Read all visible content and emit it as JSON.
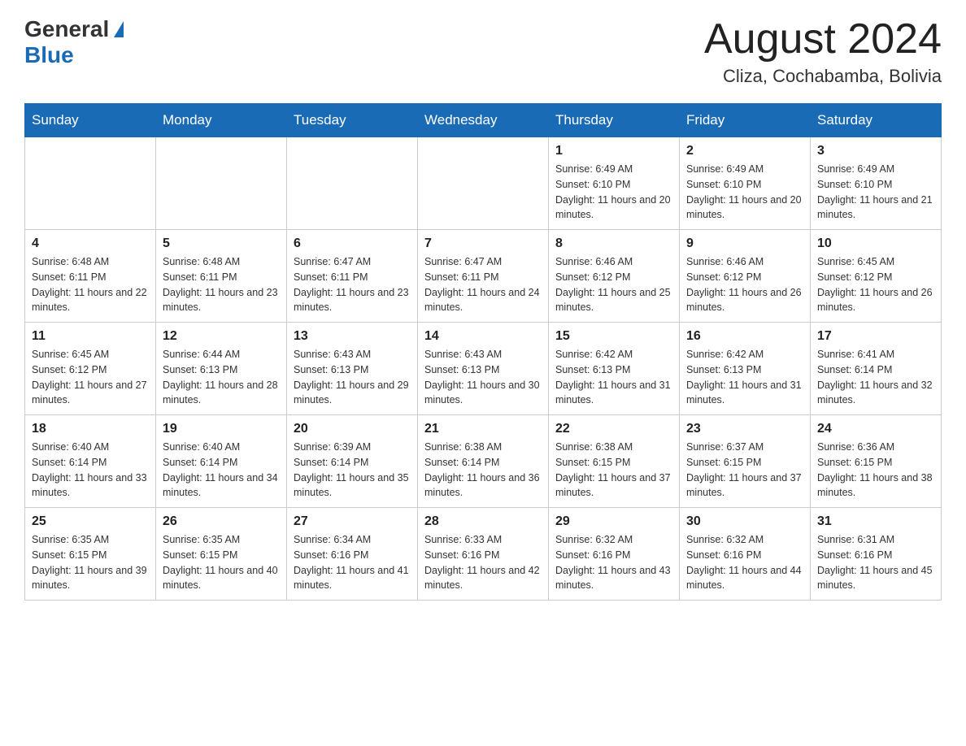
{
  "header": {
    "logo_general": "General",
    "logo_blue": "Blue",
    "title": "August 2024",
    "location": "Cliza, Cochabamba, Bolivia"
  },
  "days_of_week": [
    "Sunday",
    "Monday",
    "Tuesday",
    "Wednesday",
    "Thursday",
    "Friday",
    "Saturday"
  ],
  "weeks": [
    [
      {
        "day": "",
        "info": ""
      },
      {
        "day": "",
        "info": ""
      },
      {
        "day": "",
        "info": ""
      },
      {
        "day": "",
        "info": ""
      },
      {
        "day": "1",
        "info": "Sunrise: 6:49 AM\nSunset: 6:10 PM\nDaylight: 11 hours and 20 minutes."
      },
      {
        "day": "2",
        "info": "Sunrise: 6:49 AM\nSunset: 6:10 PM\nDaylight: 11 hours and 20 minutes."
      },
      {
        "day": "3",
        "info": "Sunrise: 6:49 AM\nSunset: 6:10 PM\nDaylight: 11 hours and 21 minutes."
      }
    ],
    [
      {
        "day": "4",
        "info": "Sunrise: 6:48 AM\nSunset: 6:11 PM\nDaylight: 11 hours and 22 minutes."
      },
      {
        "day": "5",
        "info": "Sunrise: 6:48 AM\nSunset: 6:11 PM\nDaylight: 11 hours and 23 minutes."
      },
      {
        "day": "6",
        "info": "Sunrise: 6:47 AM\nSunset: 6:11 PM\nDaylight: 11 hours and 23 minutes."
      },
      {
        "day": "7",
        "info": "Sunrise: 6:47 AM\nSunset: 6:11 PM\nDaylight: 11 hours and 24 minutes."
      },
      {
        "day": "8",
        "info": "Sunrise: 6:46 AM\nSunset: 6:12 PM\nDaylight: 11 hours and 25 minutes."
      },
      {
        "day": "9",
        "info": "Sunrise: 6:46 AM\nSunset: 6:12 PM\nDaylight: 11 hours and 26 minutes."
      },
      {
        "day": "10",
        "info": "Sunrise: 6:45 AM\nSunset: 6:12 PM\nDaylight: 11 hours and 26 minutes."
      }
    ],
    [
      {
        "day": "11",
        "info": "Sunrise: 6:45 AM\nSunset: 6:12 PM\nDaylight: 11 hours and 27 minutes."
      },
      {
        "day": "12",
        "info": "Sunrise: 6:44 AM\nSunset: 6:13 PM\nDaylight: 11 hours and 28 minutes."
      },
      {
        "day": "13",
        "info": "Sunrise: 6:43 AM\nSunset: 6:13 PM\nDaylight: 11 hours and 29 minutes."
      },
      {
        "day": "14",
        "info": "Sunrise: 6:43 AM\nSunset: 6:13 PM\nDaylight: 11 hours and 30 minutes."
      },
      {
        "day": "15",
        "info": "Sunrise: 6:42 AM\nSunset: 6:13 PM\nDaylight: 11 hours and 31 minutes."
      },
      {
        "day": "16",
        "info": "Sunrise: 6:42 AM\nSunset: 6:13 PM\nDaylight: 11 hours and 31 minutes."
      },
      {
        "day": "17",
        "info": "Sunrise: 6:41 AM\nSunset: 6:14 PM\nDaylight: 11 hours and 32 minutes."
      }
    ],
    [
      {
        "day": "18",
        "info": "Sunrise: 6:40 AM\nSunset: 6:14 PM\nDaylight: 11 hours and 33 minutes."
      },
      {
        "day": "19",
        "info": "Sunrise: 6:40 AM\nSunset: 6:14 PM\nDaylight: 11 hours and 34 minutes."
      },
      {
        "day": "20",
        "info": "Sunrise: 6:39 AM\nSunset: 6:14 PM\nDaylight: 11 hours and 35 minutes."
      },
      {
        "day": "21",
        "info": "Sunrise: 6:38 AM\nSunset: 6:14 PM\nDaylight: 11 hours and 36 minutes."
      },
      {
        "day": "22",
        "info": "Sunrise: 6:38 AM\nSunset: 6:15 PM\nDaylight: 11 hours and 37 minutes."
      },
      {
        "day": "23",
        "info": "Sunrise: 6:37 AM\nSunset: 6:15 PM\nDaylight: 11 hours and 37 minutes."
      },
      {
        "day": "24",
        "info": "Sunrise: 6:36 AM\nSunset: 6:15 PM\nDaylight: 11 hours and 38 minutes."
      }
    ],
    [
      {
        "day": "25",
        "info": "Sunrise: 6:35 AM\nSunset: 6:15 PM\nDaylight: 11 hours and 39 minutes."
      },
      {
        "day": "26",
        "info": "Sunrise: 6:35 AM\nSunset: 6:15 PM\nDaylight: 11 hours and 40 minutes."
      },
      {
        "day": "27",
        "info": "Sunrise: 6:34 AM\nSunset: 6:16 PM\nDaylight: 11 hours and 41 minutes."
      },
      {
        "day": "28",
        "info": "Sunrise: 6:33 AM\nSunset: 6:16 PM\nDaylight: 11 hours and 42 minutes."
      },
      {
        "day": "29",
        "info": "Sunrise: 6:32 AM\nSunset: 6:16 PM\nDaylight: 11 hours and 43 minutes."
      },
      {
        "day": "30",
        "info": "Sunrise: 6:32 AM\nSunset: 6:16 PM\nDaylight: 11 hours and 44 minutes."
      },
      {
        "day": "31",
        "info": "Sunrise: 6:31 AM\nSunset: 6:16 PM\nDaylight: 11 hours and 45 minutes."
      }
    ]
  ]
}
